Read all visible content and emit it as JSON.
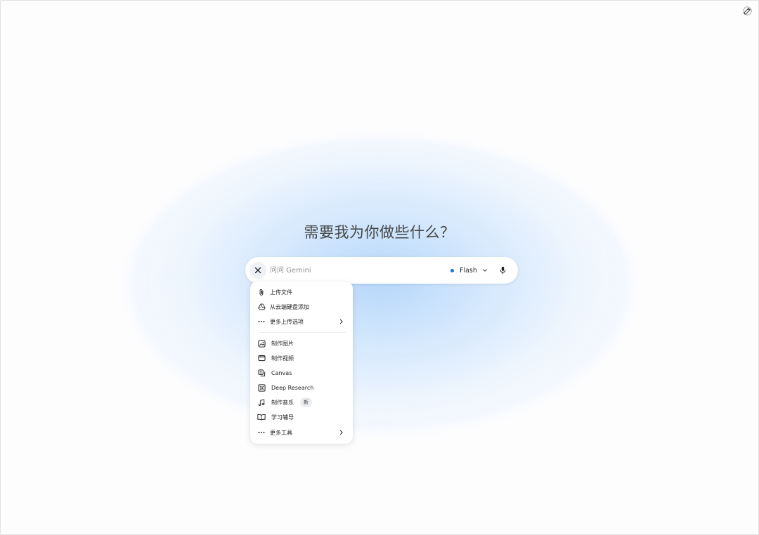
{
  "headline": "需要我为你做些什么？",
  "prompt": {
    "placeholder": "问问 Gemini",
    "value": ""
  },
  "model": {
    "label": "Flash",
    "dot_color": "#1a73e8"
  },
  "menu": {
    "upload_items": [
      {
        "label": "上传文件",
        "icon": "paperclip-icon"
      },
      {
        "label": "从云端硬盘添加",
        "icon": "drive-icon"
      },
      {
        "label": "更多上传选项",
        "icon": "more-horiz-icon"
      }
    ],
    "tool_items": [
      {
        "label": "制作图片",
        "icon": "image-icon"
      },
      {
        "label": "制作视频",
        "icon": "video-icon"
      },
      {
        "label": "Canvas",
        "icon": "canvas-icon"
      },
      {
        "label": "Deep Research",
        "icon": "deep-research-icon"
      },
      {
        "label": "制作音乐",
        "icon": "music-note-icon",
        "badge": "新"
      },
      {
        "label": "学习辅导",
        "icon": "book-icon"
      },
      {
        "label": "更多工具",
        "icon": "more-horiz-icon"
      }
    ]
  }
}
